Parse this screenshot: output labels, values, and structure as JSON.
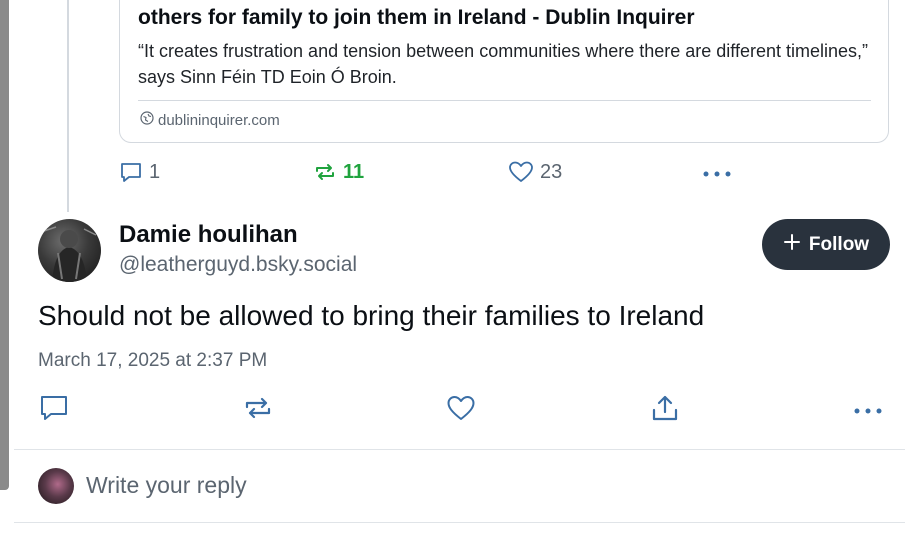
{
  "parent_post": {
    "link_card": {
      "title": "others for family to join them in Ireland - Dublin Inquirer",
      "description": "“It creates frustration and tension between communities where there are different timelines,” says Sinn Féin TD Eoin Ó Broin.",
      "domain": "dublininquirer.com",
      "domain_icon": "globe-icon"
    },
    "stats": {
      "replies": "1",
      "reposts": "11",
      "likes": "23"
    }
  },
  "post": {
    "author_name": "Damie houlihan",
    "author_handle": "@leatherguyd.bsky.social",
    "follow_label": "Follow",
    "text": "Should not be allowed to bring their families to Ireland",
    "timestamp": "March 17, 2025 at 2:37 PM"
  },
  "reply": {
    "placeholder": "Write your reply"
  },
  "colors": {
    "follow_bg": "#29323d",
    "repost_active": "#20a33e",
    "muted_text": "#5b6570",
    "icon_blue": "#3a6ea5"
  }
}
